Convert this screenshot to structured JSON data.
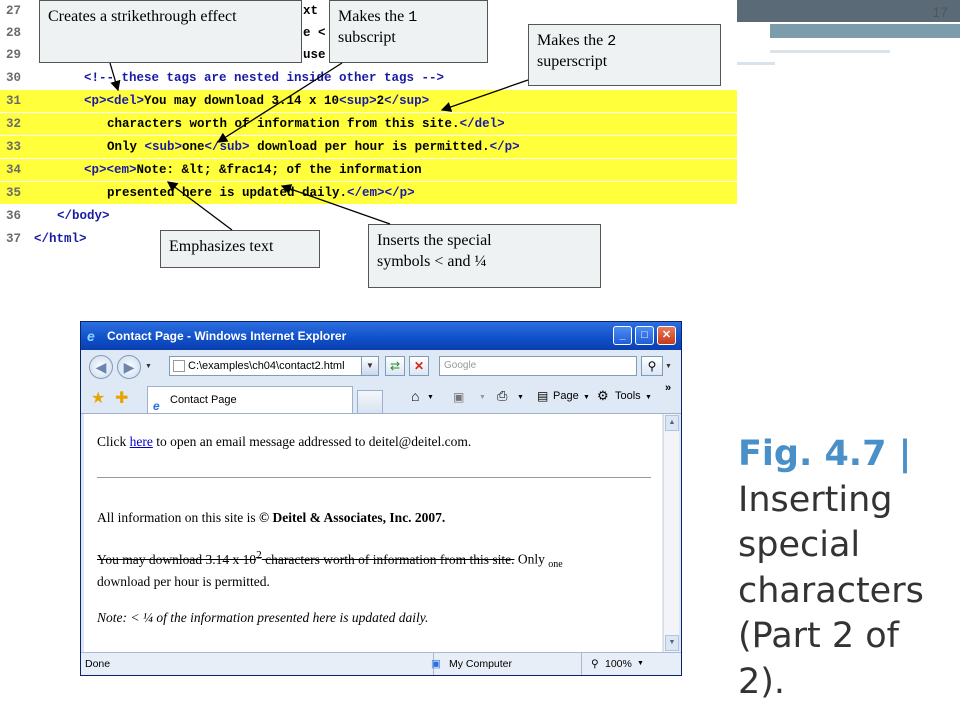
{
  "slide_number": "17",
  "code_lines": [
    {
      "num": "27",
      "pre": "",
      "text": ""
    },
    {
      "num": "28",
      "pre": "",
      "text": ""
    },
    {
      "num": "29",
      "pre": "",
      "text": ""
    },
    {
      "num": "30",
      "pre": "      ",
      "text": "<!-- these tags are nested inside other tags -->"
    },
    {
      "num": "31",
      "pre": "      ",
      "text": "<p><del>You may download 3.14 x 10<sup>2</sup>"
    },
    {
      "num": "32",
      "pre": "         ",
      "text": "characters worth of information from this site.</del>"
    },
    {
      "num": "33",
      "pre": "         ",
      "text": "Only <sub>one</sub> download per hour is permitted.</p>"
    },
    {
      "num": "34",
      "pre": "      ",
      "text": "<p><em>Note: &lt; &frac14; of the information"
    },
    {
      "num": "35",
      "pre": "         ",
      "text": "presented here is updated daily.</em></p>"
    },
    {
      "num": "36",
      "pre": "   ",
      "text": "</body>"
    },
    {
      "num": "37",
      "pre": "",
      "text": "</html>"
    }
  ],
  "partial_code": {
    "l27": "xt",
    "l28": "e <",
    "l29": "use"
  },
  "callouts": {
    "strike": "Creates a strikethrough effect",
    "sub_pre": "Makes the ",
    "sub_code": "1",
    "sub_post": "subscript",
    "sup_pre": "Makes the ",
    "sup_code": "2",
    "sup_post": "superscript",
    "emph": "Emphasizes text",
    "special_line1": "Inserts the special",
    "special_line2": "symbols < and ¼"
  },
  "browser": {
    "title": "Contact Page - Windows Internet Explorer",
    "address": "C:\\examples\\ch04\\contact2.html",
    "search_placeholder": "Google",
    "tab_label": "Contact Page",
    "toolbar_page": "Page",
    "toolbar_tools": "Tools",
    "status_left": "Done",
    "status_zone": "My Computer",
    "zoom": "100%",
    "content": {
      "click_pre": "Click ",
      "click_link": "here",
      "click_post": " to open an email message addressed to deitel@deitel.com.",
      "info_pre": "All information on this site is ",
      "info_bold": "© Deitel & Associates, Inc. 2007.",
      "del_text_a": "You may download 3.14 x 10",
      "del_sup": "2",
      "del_text_b": " characters worth of information from this site.",
      "only": " Only ",
      "sub_one": "one",
      "download_line": "download per hour is permitted.",
      "note": "Note: < ¼ of the information presented here is updated daily."
    }
  },
  "caption": {
    "fig": "Fig. 4.7 |",
    "text": "Inserting special characters (Part 2 of 2)."
  },
  "colors": {
    "highlight": "#ffff3c",
    "tag_blue": "#1a1aa6",
    "caption_accent": "#4a90c8"
  }
}
